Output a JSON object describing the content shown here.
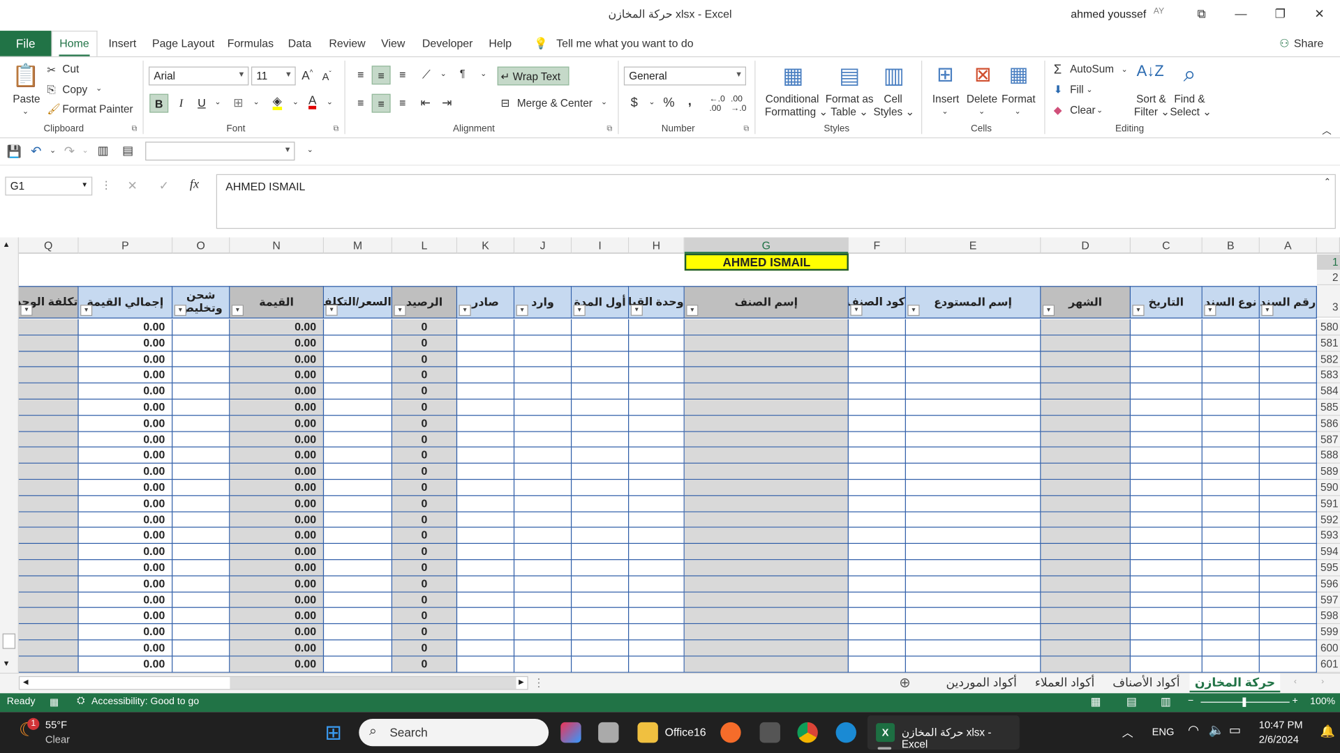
{
  "window": {
    "title": "حركة المخازن xlsx -  Excel",
    "user": "ahmed youssef",
    "avatar": "AY"
  },
  "tabs": [
    "Home",
    "Insert",
    "Page Layout",
    "Formulas",
    "Data",
    "Review",
    "View",
    "Developer",
    "Help"
  ],
  "file_tab": "File",
  "tell_me": "Tell me what you want to do",
  "share": "Share",
  "clipboard": {
    "paste": "Paste",
    "cut": "Cut",
    "copy": "Copy",
    "format_painter": "Format Painter",
    "label": "Clipboard"
  },
  "font": {
    "name": "Arial",
    "size": "11",
    "bold": "B",
    "italic": "I",
    "underline": "U",
    "label": "Font"
  },
  "alignment": {
    "wrap": "Wrap Text",
    "merge": "Merge & Center",
    "label": "Alignment"
  },
  "number": {
    "format": "General",
    "currency": "$",
    "percent": "%",
    "comma": ",",
    "label": "Number"
  },
  "styles": {
    "conditional": "Conditional",
    "formatting": "Formatting",
    "format_as": "Format as",
    "table": "Table",
    "cell": "Cell",
    "styles_word": "Styles",
    "label": "Styles"
  },
  "cells": {
    "insert": "Insert",
    "delete": "Delete",
    "format": "Format",
    "label": "Cells"
  },
  "editing": {
    "autosum": "AutoSum",
    "fill": "Fill",
    "clear": "Clear",
    "sort": "Sort &",
    "filter": "Filter",
    "find": "Find &",
    "select": "Select",
    "label": "Editing"
  },
  "formula_bar": {
    "name_box": "G1",
    "fx": "fx",
    "content": "AHMED ISMAIL"
  },
  "columns": [
    "Q",
    "P",
    "O",
    "N",
    "M",
    "L",
    "K",
    "J",
    "I",
    "H",
    "G",
    "F",
    "E",
    "D",
    "C",
    "B",
    "A"
  ],
  "title_cell": "AHMED ISMAIL",
  "headers": {
    "Q": "تكلفة الوحدة",
    "P": "إجمالي القيمة",
    "O": "شحن وتخليص",
    "N": "القيمة",
    "M": "السعر/التكلفة",
    "L": "الرصيد",
    "K": "صادر",
    "J": "وارد",
    "I": "أول المدة",
    "H": "وحدة القياس",
    "G": "إسم الصنف",
    "F": "كود الصنف",
    "E": "إسم المستودع",
    "D": "الشهر",
    "C": "التاريخ",
    "B": "نوع السند",
    "A": "رقم السند"
  },
  "rows": [
    "580",
    "581",
    "582",
    "583",
    "584",
    "585",
    "586",
    "587",
    "588",
    "589",
    "590",
    "591",
    "592",
    "593",
    "594",
    "595",
    "596",
    "597",
    "598",
    "599",
    "600",
    "601"
  ],
  "row_values": {
    "P": "0.00",
    "N": "0.00",
    "L": "0"
  },
  "top_rows": [
    "1",
    "2",
    "3"
  ],
  "sheets": [
    "حركة المخازن",
    "أكواد الأصناف",
    "أكواد العملاء",
    "أكواد الموردين"
  ],
  "status": {
    "ready": "Ready",
    "accessibility": "Accessibility: Good to go",
    "zoom": "100%"
  },
  "taskbar": {
    "temp": "55°F",
    "weather": "Clear",
    "search": "Search",
    "office": "Office16",
    "excel_task": "حركة المخازن xlsx - Excel",
    "lang": "ENG",
    "time": "10:47 PM",
    "date": "2/6/2024",
    "notif": "1"
  },
  "colors": {
    "accent": "#217346",
    "header_blue": "#c6d9f0",
    "title_yellow": "#ffff00",
    "gray": "#d9d9d9"
  }
}
